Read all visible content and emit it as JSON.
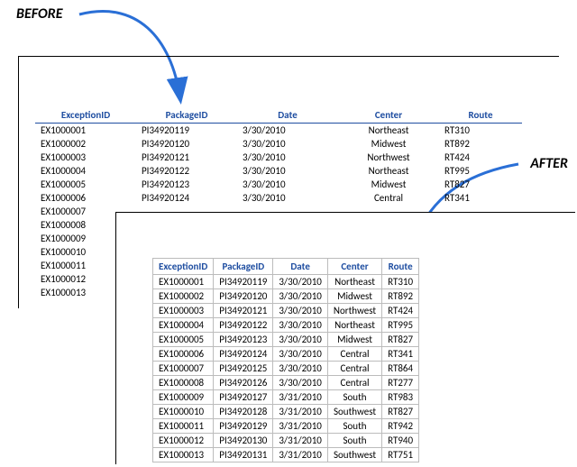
{
  "labels": {
    "before": "BEFORE",
    "after": "AFTER"
  },
  "columns": {
    "exid": "ExceptionID",
    "pkg": "PackageID",
    "date": "Date",
    "center": "Center",
    "route": "Route"
  },
  "before_rows": [
    {
      "exid": "EX1000001",
      "pkg": "PI34920119",
      "date": "3/30/2010",
      "center": "Northeast",
      "route": "RT310"
    },
    {
      "exid": "EX1000002",
      "pkg": "PI34920120",
      "date": "3/30/2010",
      "center": "Midwest",
      "route": "RT892"
    },
    {
      "exid": "EX1000003",
      "pkg": "PI34920121",
      "date": "3/30/2010",
      "center": "Northwest",
      "route": "RT424"
    },
    {
      "exid": "EX1000004",
      "pkg": "PI34920122",
      "date": "3/30/2010",
      "center": "Northeast",
      "route": "RT995"
    },
    {
      "exid": "EX1000005",
      "pkg": "PI34920123",
      "date": "3/30/2010",
      "center": "Midwest",
      "route": "RT827"
    },
    {
      "exid": "EX1000006",
      "pkg": "PI34920124",
      "date": "3/30/2010",
      "center": "Central",
      "route": "RT341"
    },
    {
      "exid": "EX1000007",
      "pkg": "",
      "date": "",
      "center": "",
      "route": ""
    },
    {
      "exid": "EX1000008",
      "pkg": "",
      "date": "",
      "center": "",
      "route": ""
    },
    {
      "exid": "EX1000009",
      "pkg": "",
      "date": "",
      "center": "",
      "route": ""
    },
    {
      "exid": "EX1000010",
      "pkg": "",
      "date": "",
      "center": "",
      "route": ""
    },
    {
      "exid": "EX1000011",
      "pkg": "",
      "date": "",
      "center": "",
      "route": ""
    },
    {
      "exid": "EX1000012",
      "pkg": "",
      "date": "",
      "center": "",
      "route": ""
    },
    {
      "exid": "EX1000013",
      "pkg": "",
      "date": "",
      "center": "",
      "route": ""
    }
  ],
  "after_rows": [
    {
      "exid": "EX1000001",
      "pkg": "PI34920119",
      "date": "3/30/2010",
      "center": "Northeast",
      "route": "RT310"
    },
    {
      "exid": "EX1000002",
      "pkg": "PI34920120",
      "date": "3/30/2010",
      "center": "Midwest",
      "route": "RT892"
    },
    {
      "exid": "EX1000003",
      "pkg": "PI34920121",
      "date": "3/30/2010",
      "center": "Northwest",
      "route": "RT424"
    },
    {
      "exid": "EX1000004",
      "pkg": "PI34920122",
      "date": "3/30/2010",
      "center": "Northeast",
      "route": "RT995"
    },
    {
      "exid": "EX1000005",
      "pkg": "PI34920123",
      "date": "3/30/2010",
      "center": "Midwest",
      "route": "RT827"
    },
    {
      "exid": "EX1000006",
      "pkg": "PI34920124",
      "date": "3/30/2010",
      "center": "Central",
      "route": "RT341"
    },
    {
      "exid": "EX1000007",
      "pkg": "PI34920125",
      "date": "3/30/2010",
      "center": "Central",
      "route": "RT864"
    },
    {
      "exid": "EX1000008",
      "pkg": "PI34920126",
      "date": "3/30/2010",
      "center": "Central",
      "route": "RT277"
    },
    {
      "exid": "EX1000009",
      "pkg": "PI34920127",
      "date": "3/31/2010",
      "center": "South",
      "route": "RT983"
    },
    {
      "exid": "EX1000010",
      "pkg": "PI34920128",
      "date": "3/31/2010",
      "center": "Southwest",
      "route": "RT827"
    },
    {
      "exid": "EX1000011",
      "pkg": "PI34920129",
      "date": "3/31/2010",
      "center": "South",
      "route": "RT942"
    },
    {
      "exid": "EX1000012",
      "pkg": "PI34920130",
      "date": "3/31/2010",
      "center": "South",
      "route": "RT940"
    },
    {
      "exid": "EX1000013",
      "pkg": "PI34920131",
      "date": "3/31/2010",
      "center": "Southwest",
      "route": "RT751"
    }
  ]
}
